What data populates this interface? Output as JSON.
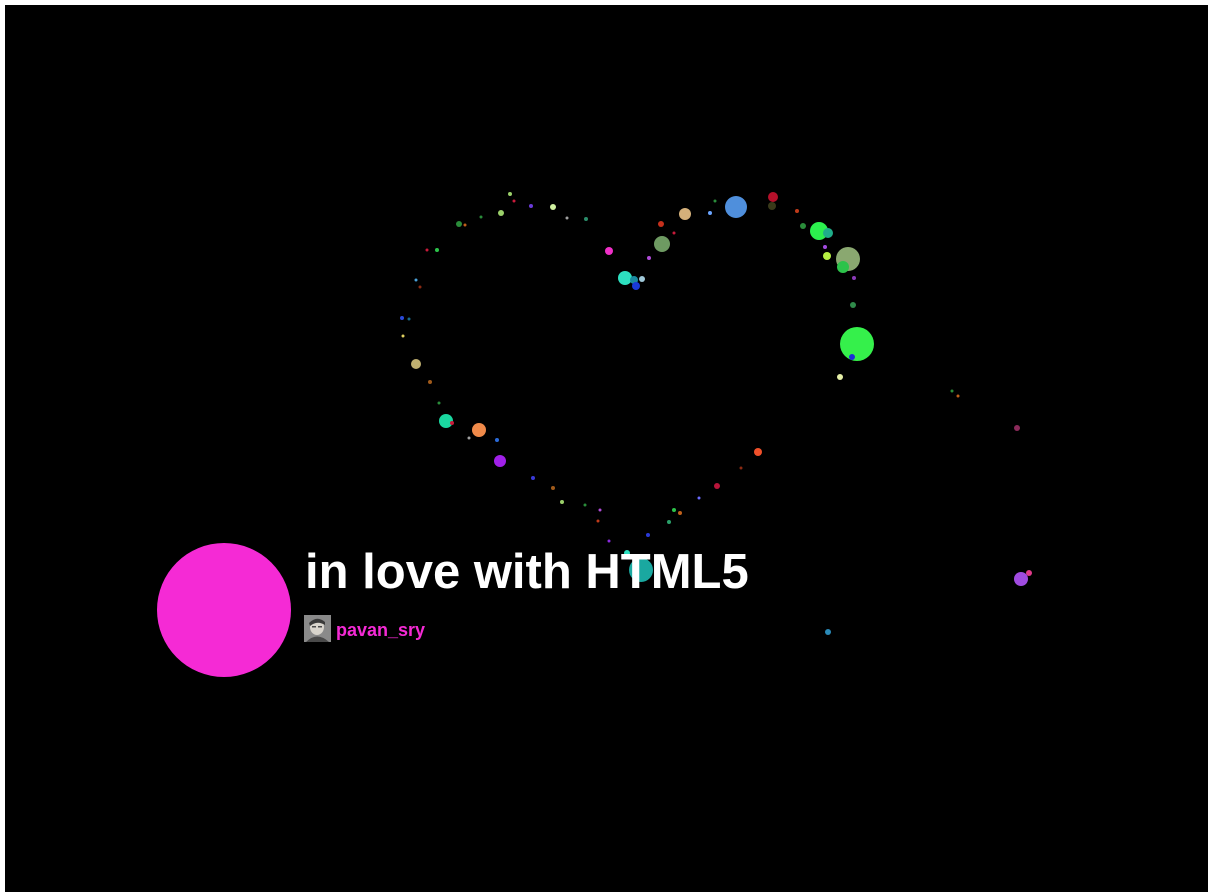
{
  "title": "in love with HTML5",
  "author": {
    "name": "pavan_sry",
    "avatar_icon": "user-photo-icon"
  },
  "colors": {
    "background": "#000000",
    "accent": "#f52ad5",
    "title_text": "#ffffff"
  }
}
